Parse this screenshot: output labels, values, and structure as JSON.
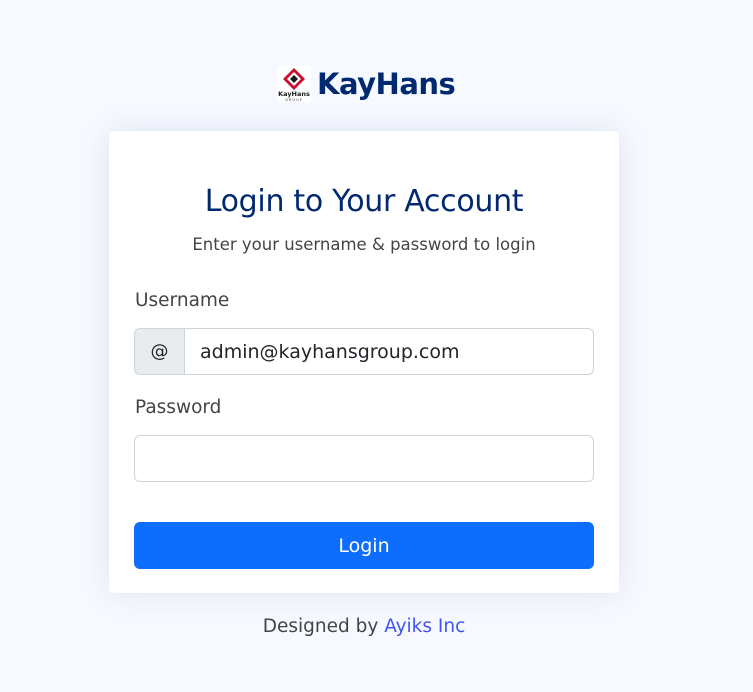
{
  "brand": {
    "name": "KayHans",
    "logo_text": "KayHans",
    "logo_subtext": "GROUP"
  },
  "card": {
    "title": "Login to Your Account",
    "subtitle": "Enter your username & password to login"
  },
  "form": {
    "username_label": "Username",
    "username_prefix": "@",
    "username_value": "admin@kayhansgroup.com",
    "password_label": "Password",
    "password_value": "",
    "submit_label": "Login"
  },
  "footer": {
    "prefix": "Designed by ",
    "link_text": "Ayiks Inc"
  },
  "colors": {
    "page_background": "#f6f9ff",
    "brand_navy": "#012970",
    "primary_button": "#0d6efd",
    "link": "#4154f1"
  }
}
